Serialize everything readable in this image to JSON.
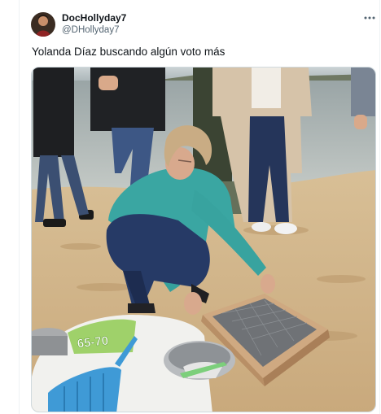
{
  "tweet": {
    "author_name": "DocHollyday7",
    "author_handle": "@DHollyday7",
    "text": "Yolanda Díaz buscando algún voto más",
    "more_icon": "more-horizontal-icon"
  },
  "media": {
    "bag_label": "65-70"
  },
  "colors": {
    "text_primary": "#0f1419",
    "text_secondary": "#536471",
    "divider": "#eff3f4",
    "border": "#cfd9de"
  }
}
